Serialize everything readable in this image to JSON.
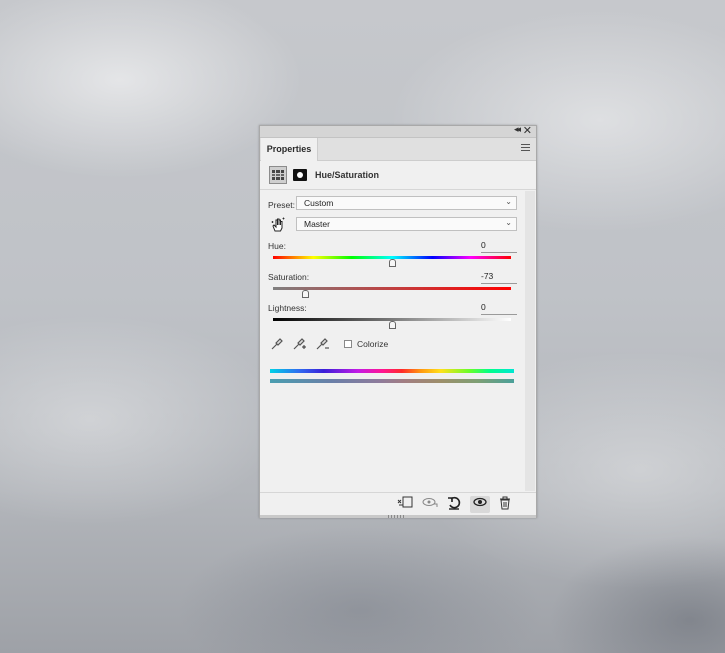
{
  "panel": {
    "tab_label": "Properties",
    "title": "Hue/Saturation",
    "icons": {
      "collapse": "double-chevron-right-icon",
      "close": "close-icon",
      "menu": "hamburger-menu-icon",
      "adjustment": "hue-saturation-adjustment-icon",
      "mask": "layer-mask-icon"
    }
  },
  "preset": {
    "label": "Preset:",
    "value": "Custom"
  },
  "channel": {
    "value": "Master"
  },
  "hue": {
    "label": "Hue:",
    "value": "0",
    "slider_fraction": 0.5
  },
  "saturation": {
    "label": "Saturation:",
    "value": "-73",
    "slider_fraction": 0.135
  },
  "lightness": {
    "label": "Lightness:",
    "value": "0",
    "slider_fraction": 0.5
  },
  "colorize": {
    "label": "Colorize",
    "checked": false
  },
  "footer": {
    "buttons": [
      "clip-to-layer-icon",
      "view-previous-state-icon",
      "reset-icon",
      "toggle-visibility-icon",
      "delete-icon"
    ]
  }
}
